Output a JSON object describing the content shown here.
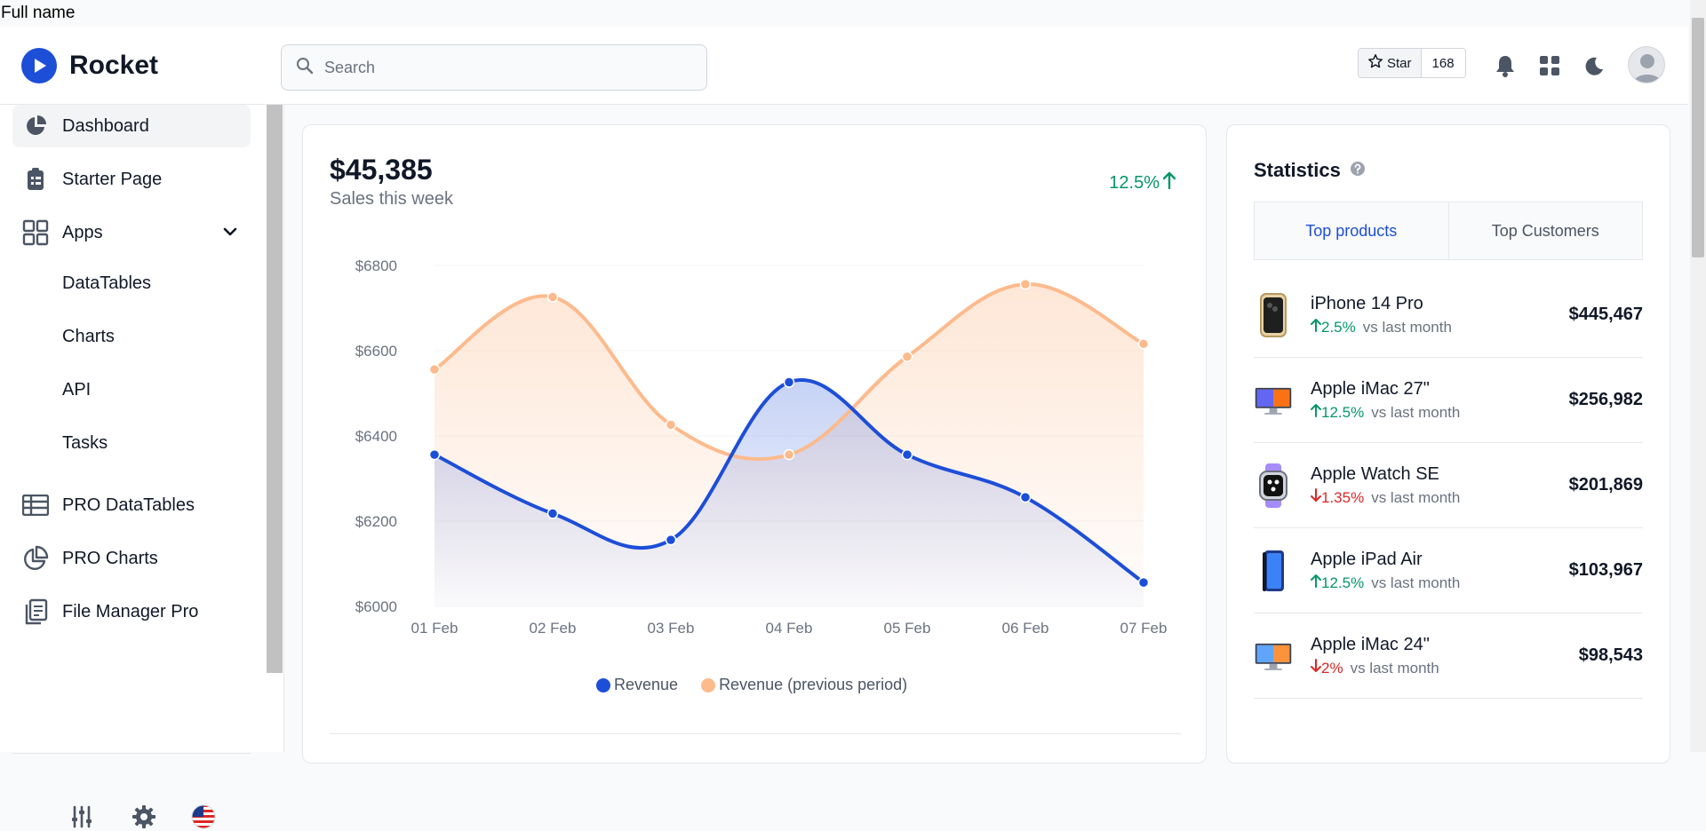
{
  "top_label": "Full name",
  "brand": {
    "name": "Rocket"
  },
  "search": {
    "placeholder": "Search"
  },
  "github": {
    "star_label": "Star",
    "star_count": "168"
  },
  "header_icons": [
    "bell-icon",
    "apps-grid-icon",
    "moon-icon",
    "user-avatar"
  ],
  "sidebar": {
    "items": [
      {
        "label": "Dashboard",
        "icon": "pie-chart-icon",
        "active": true
      },
      {
        "label": "Starter Page",
        "icon": "clipboard-icon"
      },
      {
        "label": "Apps",
        "icon": "grid-icon",
        "expanded": true
      },
      {
        "label": "PRO DataTables",
        "icon": "table-icon"
      },
      {
        "label": "PRO Charts",
        "icon": "chart-pie-icon"
      },
      {
        "label": "File Manager Pro",
        "icon": "files-icon"
      }
    ],
    "apps_children": [
      "DataTables",
      "Charts",
      "API",
      "Tasks"
    ],
    "footer_icons": [
      "sliders-icon",
      "gear-icon",
      "us-flag-icon"
    ]
  },
  "sales": {
    "amount": "$45,385",
    "subtitle": "Sales this week",
    "growth": "12.5%"
  },
  "chart_data": {
    "type": "area",
    "categories": [
      "01 Feb",
      "02 Feb",
      "03 Feb",
      "04 Feb",
      "05 Feb",
      "06 Feb",
      "07 Feb"
    ],
    "y_ticks": [
      "$6800",
      "$6600",
      "$6400",
      "$6200",
      "$6000"
    ],
    "ylim": [
      6000,
      6800
    ],
    "series": [
      {
        "name": "Revenue",
        "color": "#1d4ed8",
        "values": [
          6356,
          6218,
          6156,
          6526,
          6356,
          6256,
          6056
        ]
      },
      {
        "name": "Revenue (previous period)",
        "color": "#fdba8c",
        "values": [
          6556,
          6726,
          6426,
          6356,
          6586,
          6756,
          6616
        ]
      }
    ],
    "grid": true,
    "legend": "bottom"
  },
  "statistics": {
    "title": "Statistics",
    "tabs": [
      "Top products",
      "Top Customers"
    ],
    "active_tab": 0,
    "products": [
      {
        "name": "iPhone 14 Pro",
        "change": "2.5%",
        "direction": "up",
        "suffix": "vs last month",
        "price": "$445,467"
      },
      {
        "name": "Apple iMac 27\"",
        "change": "12.5%",
        "direction": "up",
        "suffix": "vs last month",
        "price": "$256,982"
      },
      {
        "name": "Apple Watch SE",
        "change": "1.35%",
        "direction": "down",
        "suffix": "vs last month",
        "price": "$201,869"
      },
      {
        "name": "Apple iPad Air",
        "change": "12.5%",
        "direction": "up",
        "suffix": "vs last month",
        "price": "$103,967"
      },
      {
        "name": "Apple iMac 24\"",
        "change": "2%",
        "direction": "down",
        "suffix": "vs last month",
        "price": "$98,543"
      }
    ]
  },
  "colors": {
    "accent": "#1d4ed8",
    "positive": "#059669",
    "negative": "#dc2626",
    "previous": "#fdba8c"
  }
}
